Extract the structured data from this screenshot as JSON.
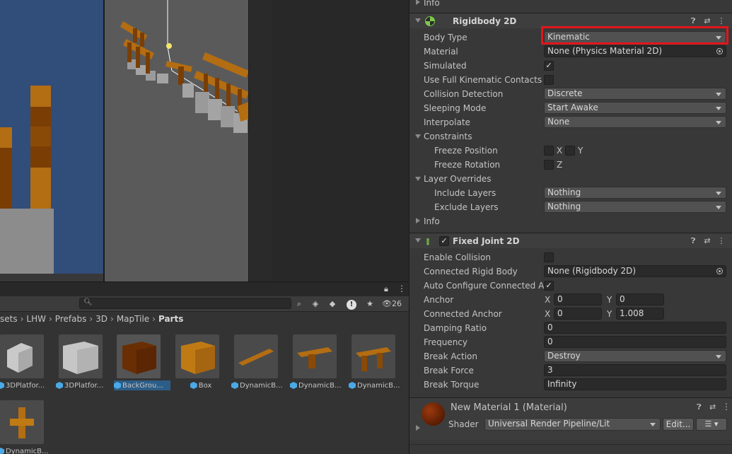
{
  "colors": {
    "accent_highlight": "#e3151a",
    "inspector_bg": "#383838",
    "game_sky": "#314d79",
    "selection": "#2c5d87",
    "toggle_green": "#7cc94a"
  },
  "project": {
    "search_placeholder": "",
    "hidden_count": "26",
    "breadcrumb": [
      "sets",
      "LHW",
      "Prefabs",
      "3D",
      "MapTile",
      "Parts"
    ],
    "assets": [
      {
        "label": "3DPlatfor...",
        "icon": "prefab-icon",
        "thumb": "gray-block"
      },
      {
        "label": "3DPlatfor...",
        "icon": "prefab-icon",
        "thumb": "gray-cube"
      },
      {
        "label": "BackGrou...",
        "icon": "prefab-icon",
        "thumb": "brown-cube",
        "selected": true
      },
      {
        "label": "Box",
        "icon": "prefab-icon",
        "thumb": "orange-cube"
      },
      {
        "label": "DynamicB...",
        "icon": "prefab-icon",
        "thumb": "plank"
      },
      {
        "label": "DynamicB...",
        "icon": "prefab-icon",
        "thumb": "t-platform"
      },
      {
        "label": "DynamicB...",
        "icon": "prefab-icon",
        "thumb": "table"
      },
      {
        "label": "DynamicB...",
        "icon": "prefab-icon",
        "thumb": "cross-piece"
      }
    ]
  },
  "inspector": {
    "top_info": "Info",
    "rigidbody": {
      "title": "Rigidbody 2D",
      "body_type_label": "Body Type",
      "body_type": "Kinematic",
      "material_label": "Material",
      "material": "None (Physics Material 2D)",
      "simulated_label": "Simulated",
      "full_kinematic_label": "Use Full Kinematic Contacts",
      "collision_label": "Collision Detection",
      "collision": "Discrete",
      "sleeping_label": "Sleeping Mode",
      "sleeping": "Start Awake",
      "interpolate_label": "Interpolate",
      "interpolate": "None",
      "constraints_label": "Constraints",
      "freeze_pos_label": "Freeze Position",
      "freeze_rot_label": "Freeze Rotation",
      "axis_x": "X",
      "axis_y": "Y",
      "axis_z": "Z",
      "layer_overrides_label": "Layer Overrides",
      "include_label": "Include Layers",
      "include": "Nothing",
      "exclude_label": "Exclude Layers",
      "exclude": "Nothing",
      "info_label": "Info"
    },
    "fixed_joint": {
      "title": "Fixed Joint 2D",
      "enable_collision_label": "Enable Collision",
      "connected_body_label": "Connected Rigid Body",
      "connected_body": "None (Rigidbody 2D)",
      "auto_config_label": "Auto Configure Connected An",
      "anchor_label": "Anchor",
      "anchor_x": "0",
      "anchor_y": "0",
      "connected_anchor_label": "Connected Anchor",
      "connected_anchor_x": "0",
      "connected_anchor_y": "1.008",
      "damping_label": "Damping Ratio",
      "damping": "0",
      "frequency_label": "Frequency",
      "frequency": "0",
      "break_action_label": "Break Action",
      "break_action": "Destroy",
      "break_force_label": "Break Force",
      "break_force": "3",
      "break_torque_label": "Break Torque",
      "break_torque": "Infinity"
    },
    "material": {
      "title": "New Material 1 (Material)",
      "shader_label": "Shader",
      "shader": "Universal Render Pipeline/Lit",
      "edit_label": "Edit...",
      "list_icon": "list-icon"
    },
    "header_icons": [
      "help-icon",
      "preset-icon",
      "kebab-icon"
    ]
  }
}
